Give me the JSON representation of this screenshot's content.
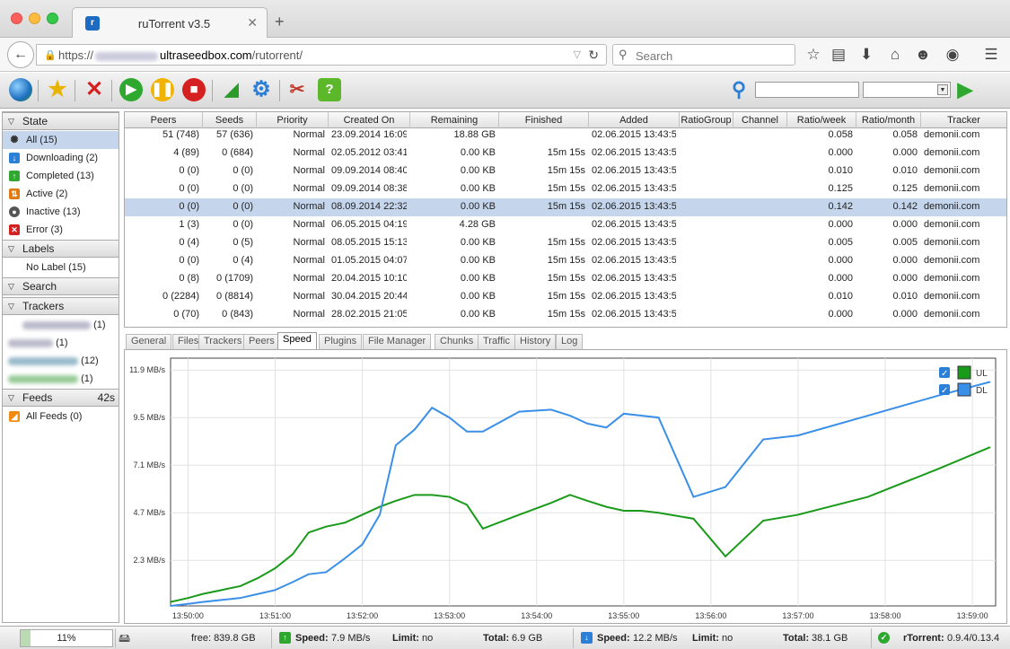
{
  "browser": {
    "tab_title": "ruTorrent v3.5",
    "url_prefix": "https://",
    "url_host": "ultraseedbox.com",
    "url_path": "/rutorrent/",
    "search_placeholder": "Search"
  },
  "sidebar": {
    "state_header": "State",
    "state_items": [
      {
        "label": "All (15)",
        "icon": "all-icon"
      },
      {
        "label": "Downloading (2)",
        "icon": "downloading-icon"
      },
      {
        "label": "Completed (13)",
        "icon": "completed-icon"
      },
      {
        "label": "Active (2)",
        "icon": "active-icon"
      },
      {
        "label": "Inactive (13)",
        "icon": "inactive-icon"
      },
      {
        "label": "Error (3)",
        "icon": "error-icon"
      }
    ],
    "labels_header": "Labels",
    "labels_items": [
      {
        "label": "No Label (15)"
      }
    ],
    "search_header": "Search",
    "trackers_header": "Trackers",
    "tracker_counts": [
      "(1)",
      "(1)",
      "(12)",
      "(1)"
    ],
    "feeds_header": "Feeds",
    "feeds_timer": "42s",
    "feeds_items": [
      {
        "label": "All Feeds (0)"
      }
    ]
  },
  "table": {
    "columns": [
      "Peers",
      "Seeds",
      "Priority",
      "Created On",
      "Remaining",
      "Finished",
      "Added",
      "RatioGroup",
      "Channel",
      "Ratio/week",
      "Ratio/month",
      "Tracker"
    ],
    "rows": [
      [
        "51 (748)",
        "57 (636)",
        "Normal",
        "23.09.2014 16:09:2",
        "18.88 GB",
        "",
        "02.06.2015 13:43:5",
        "",
        "",
        "0.058",
        "0.058",
        "demonii.com"
      ],
      [
        "4 (89)",
        "0 (684)",
        "Normal",
        "02.05.2012 03:41:5",
        "0.00 KB",
        "15m 15s",
        "02.06.2015 13:43:5",
        "",
        "",
        "0.000",
        "0.000",
        "demonii.com"
      ],
      [
        "0 (0)",
        "0 (0)",
        "Normal",
        "09.09.2014 08:40:4",
        "0.00 KB",
        "15m 15s",
        "02.06.2015 13:43:5",
        "",
        "",
        "0.010",
        "0.010",
        "demonii.com"
      ],
      [
        "0 (0)",
        "0 (0)",
        "Normal",
        "09.09.2014 08:38:2",
        "0.00 KB",
        "15m 15s",
        "02.06.2015 13:43:5",
        "",
        "",
        "0.125",
        "0.125",
        "demonii.com"
      ],
      [
        "0 (0)",
        "0 (0)",
        "Normal",
        "08.09.2014 22:32:3",
        "0.00 KB",
        "15m 15s",
        "02.06.2015 13:43:5",
        "",
        "",
        "0.142",
        "0.142",
        "demonii.com"
      ],
      [
        "1 (3)",
        "0 (0)",
        "Normal",
        "06.05.2015 04:19:5",
        "4.28 GB",
        "",
        "02.06.2015 13:43:5",
        "",
        "",
        "0.000",
        "0.000",
        "demonii.com"
      ],
      [
        "0 (4)",
        "0 (5)",
        "Normal",
        "08.05.2015 15:13:4",
        "0.00 KB",
        "15m 15s",
        "02.06.2015 13:43:5",
        "",
        "",
        "0.005",
        "0.005",
        "demonii.com"
      ],
      [
        "0 (0)",
        "0 (4)",
        "Normal",
        "01.05.2015 04:07:2",
        "0.00 KB",
        "15m 15s",
        "02.06.2015 13:43:5",
        "",
        "",
        "0.000",
        "0.000",
        "demonii.com"
      ],
      [
        "0 (8)",
        "0 (1709)",
        "Normal",
        "20.04.2015 10:10:4",
        "0.00 KB",
        "15m 15s",
        "02.06.2015 13:43:5",
        "",
        "",
        "0.000",
        "0.000",
        "demonii.com"
      ],
      [
        "0 (2284)",
        "0 (8814)",
        "Normal",
        "30.04.2015 20:44:5",
        "0.00 KB",
        "15m 15s",
        "02.06.2015 13:43:5",
        "",
        "",
        "0.010",
        "0.010",
        "demonii.com"
      ],
      [
        "0 (70)",
        "0 (843)",
        "Normal",
        "28.02.2015 21:05:1",
        "0.00 KB",
        "15m 15s",
        "02.06.2015 13:43:5",
        "",
        "",
        "0.000",
        "0.000",
        "demonii.com"
      ]
    ]
  },
  "bottom_tabs": [
    "General",
    "Files",
    "Trackers",
    "Peers",
    "Speed",
    "Plugins",
    "File Manager",
    "Chunks",
    "Traffic",
    "History",
    "Log"
  ],
  "active_tab": "Speed",
  "chart_data": {
    "type": "line",
    "x": [
      "13:49:48",
      "13:50:00",
      "13:50:10",
      "13:50:23",
      "13:50:36",
      "13:50:48",
      "13:51:00",
      "13:51:12",
      "13:51:23",
      "13:51:35",
      "13:51:48",
      "13:52:00",
      "13:52:12",
      "13:52:23",
      "13:52:36",
      "13:52:48",
      "13:53:00",
      "13:53:12",
      "13:53:23",
      "13:53:48",
      "13:54:10",
      "13:54:23",
      "13:54:35",
      "13:54:48",
      "13:55:00",
      "13:55:12",
      "13:55:24",
      "13:55:48",
      "13:56:10",
      "13:56:36",
      "13:57:00",
      "13:57:48",
      "13:58:36",
      "13:59:12"
    ],
    "series": [
      {
        "name": "UL",
        "color": "#1a9a1a",
        "values": [
          0.2,
          0.4,
          0.6,
          0.8,
          1.0,
          1.4,
          1.9,
          2.6,
          3.7,
          4.0,
          4.2,
          4.6,
          5.0,
          5.3,
          5.6,
          5.6,
          5.5,
          5.1,
          3.9,
          4.6,
          5.2,
          5.6,
          5.3,
          5.0,
          4.8,
          4.8,
          4.7,
          4.4,
          2.5,
          4.3,
          4.6,
          5.5,
          6.9,
          8.0
        ]
      },
      {
        "name": "DL",
        "color": "#3a8fe8",
        "values": [
          0.0,
          0.1,
          0.2,
          0.3,
          0.4,
          0.6,
          0.8,
          1.2,
          1.6,
          1.7,
          2.4,
          3.1,
          4.6,
          8.1,
          8.9,
          10.0,
          9.5,
          8.8,
          8.8,
          9.8,
          9.9,
          9.6,
          9.2,
          9.0,
          9.7,
          9.6,
          9.5,
          5.5,
          6.0,
          8.4,
          8.6,
          9.6,
          10.6,
          11.3
        ]
      }
    ],
    "y_ticks": [
      "2.3 MB/s",
      "4.7 MB/s",
      "7.1 MB/s",
      "9.5 MB/s",
      "11.9 MB/s"
    ],
    "y_tick_values": [
      2.3,
      4.7,
      7.1,
      9.5,
      11.9
    ],
    "x_ticks": [
      "13:50:00",
      "13:51:00",
      "13:52:00",
      "13:53:00",
      "13:54:00",
      "13:55:00",
      "13:56:00",
      "13:57:00",
      "13:58:00",
      "13:59:00"
    ],
    "ylim": [
      0,
      12.5
    ],
    "legend": [
      "UL",
      "DL"
    ],
    "legend_position": "top-right",
    "grid": true
  },
  "statusbar": {
    "disk_percent": "11%",
    "disk_fill": 0.11,
    "free": "free: 839.8 GB",
    "ul_speed_label": "Speed:",
    "ul_speed_value": "7.9 MB/s",
    "ul_limit_label": "Limit:",
    "ul_limit_value": "no",
    "ul_total_label": "Total:",
    "ul_total_value": "6.9 GB",
    "dl_speed_label": "Speed:",
    "dl_speed_value": "12.2 MB/s",
    "dl_limit_label": "Limit:",
    "dl_limit_value": "no",
    "dl_total_label": "Total:",
    "dl_total_value": "38.1 GB",
    "version_label": "rTorrent:",
    "version_value": "0.9.4/0.13.4"
  }
}
